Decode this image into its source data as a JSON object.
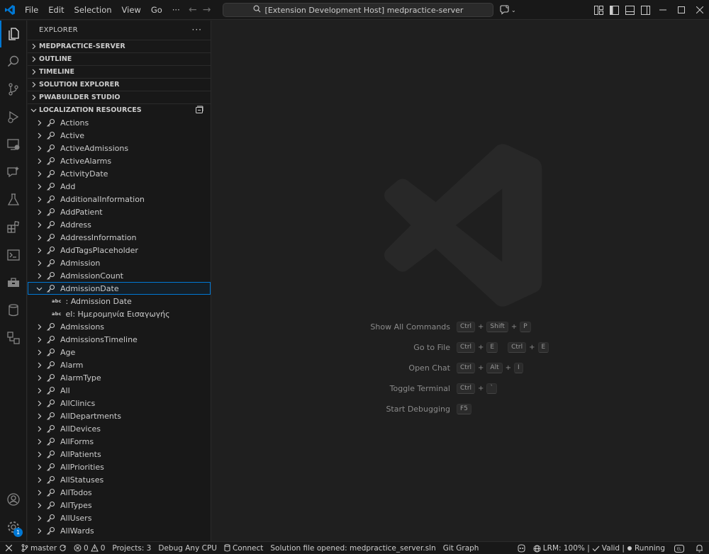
{
  "titlebar": {
    "menu": [
      "File",
      "Edit",
      "Selection",
      "View",
      "Go",
      "···"
    ],
    "search_text": "[Extension Development Host] medpractice-server"
  },
  "activitybar": {
    "items": [
      "explorer-icon",
      "search-icon",
      "source-control-icon",
      "run-debug-icon",
      "remote-explorer-icon",
      "chat-icon",
      "testing-icon",
      "extensions-icon",
      "terminal-icon",
      "toolbox-icon",
      "database-icon",
      "solution-icon"
    ],
    "bottom": [
      "account-icon",
      "settings-gear-icon"
    ],
    "settings_badge": "1"
  },
  "sidebar": {
    "title": "EXPLORER",
    "more": "···",
    "sections": [
      "MEDPRACTICE-SERVER",
      "OUTLINE",
      "TIMELINE",
      "SOLUTION EXPLORER",
      "PWABUILDER STUDIO"
    ],
    "localization_title": "LOCALIZATION RESOURCES",
    "items_before": [
      "Actions",
      "Active",
      "ActiveAdmissions",
      "ActiveAlarms",
      "ActivityDate",
      "Add",
      "AdditionalInformation",
      "AddPatient",
      "Address",
      "AddressInformation",
      "AddTagsPlaceholder",
      "Admission",
      "AdmissionCount"
    ],
    "selected_item": "AdmissionDate",
    "children": [
      {
        "tag": "abc",
        "text": ": Admission Date"
      },
      {
        "tag": "abc",
        "text": "el: Ημερομηνία Εισαγωγής"
      }
    ],
    "items_after": [
      "Admissions",
      "AdmissionsTimeline",
      "Age",
      "Alarm",
      "AlarmType",
      "All",
      "AllClinics",
      "AllDepartments",
      "AllDevices",
      "AllForms",
      "AllPatients",
      "AllPriorities",
      "AllStatuses",
      "AllTodos",
      "AllTypes",
      "AllUsers",
      "AllWards"
    ]
  },
  "editor": {
    "shortcuts": [
      {
        "label": "Show All Commands",
        "keys": [
          [
            "Ctrl",
            "Shift",
            "P"
          ]
        ]
      },
      {
        "label": "Go to File",
        "keys": [
          [
            "Ctrl",
            "E"
          ],
          [
            "Ctrl",
            "E"
          ]
        ]
      },
      {
        "label": "Open Chat",
        "keys": [
          [
            "Ctrl",
            "Alt",
            "I"
          ]
        ]
      },
      {
        "label": "Toggle Terminal",
        "keys": [
          [
            "Ctrl",
            "`"
          ]
        ]
      },
      {
        "label": "Start Debugging",
        "keys": [
          [
            "F5"
          ]
        ]
      }
    ]
  },
  "statusbar": {
    "remote": "✕",
    "branch": "master",
    "errors": "0",
    "warnings": "0",
    "projects": "Projects: 3",
    "debug_config": "Debug Any CPU",
    "connect": "Connect",
    "solution": "Solution file opened: medpractice_server.sln",
    "git_graph": "Git Graph",
    "lrm": "LRM: 100% |",
    "valid": "Valid |",
    "running": "Running"
  },
  "colors": {
    "accent": "#0078d4",
    "sidebar_bg": "#181818",
    "editor_bg": "#1f1f1f"
  }
}
